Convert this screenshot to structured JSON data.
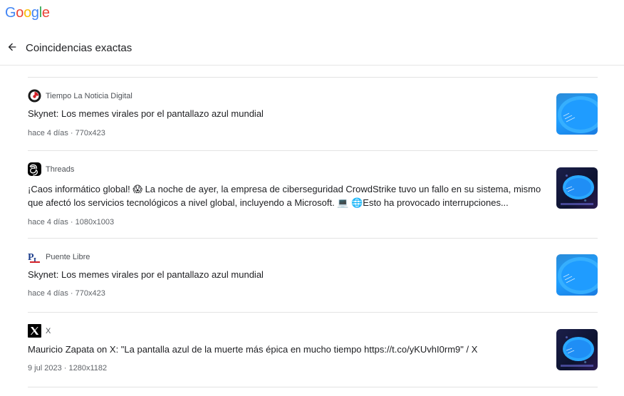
{
  "logo": {
    "text": "Google"
  },
  "header": {
    "title": "Coincidencias exactas"
  },
  "results": [
    {
      "source": "Tiempo La Noticia Digital",
      "favicon": "tiempo-icon",
      "title": "Skynet: Los memes virales por el pantallazo azul mundial",
      "meta": "hace 4 días · 770x423",
      "thumb_style": "light"
    },
    {
      "source": "Threads",
      "favicon": "threads-icon",
      "title": "¡Caos informático global! 😱 La noche de ayer, la empresa de ciberseguridad CrowdStrike tuvo un fallo en su sistema, mismo que afectó los servicios tecnológicos a nivel global, incluyendo a Microsoft. 💻 🌐Esto ha provocado interrupciones...",
      "meta": "hace 4 días · 1080x1003",
      "thumb_style": "dark"
    },
    {
      "source": "Puente Libre",
      "favicon": "puente-libre-icon",
      "title": "Skynet: Los memes virales por el pantallazo azul mundial",
      "meta": "hace 4 días · 770x423",
      "thumb_style": "light"
    },
    {
      "source": "X",
      "favicon": "x-icon",
      "title": "Mauricio Zapata on X: \"La pantalla azul de la muerte más épica en mucho tiempo https://t.co/yKUvhI0rm9\" / X",
      "meta": "9 jul 2023 · 1280x1182",
      "thumb_style": "dark"
    }
  ],
  "colors": {
    "google_blue": "#4285f4",
    "google_red": "#ea4335",
    "google_yellow": "#fbbc05",
    "google_green": "#34a853",
    "divider": "#e3e3e3"
  }
}
